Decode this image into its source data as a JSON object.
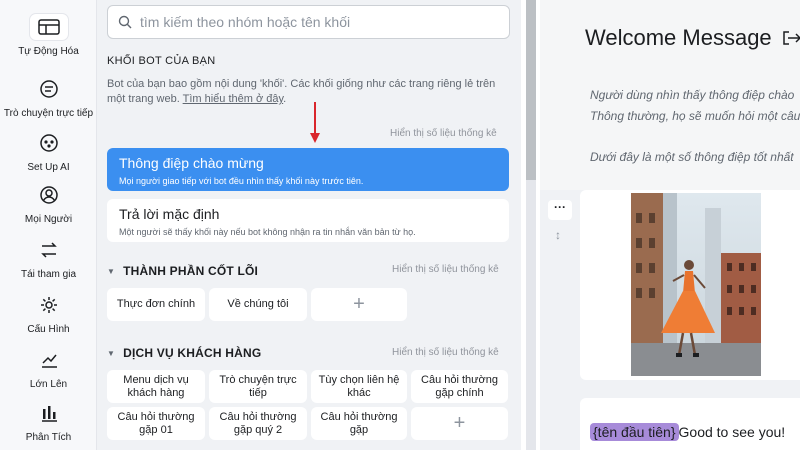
{
  "nav": {
    "items": [
      {
        "label": "Tự Động Hóa",
        "icon": "automation-icon"
      },
      {
        "label": "Trò chuyện trực tiếp",
        "icon": "chat-icon"
      },
      {
        "label": "Set Up AI",
        "icon": "ai-icon"
      },
      {
        "label": "Mọi Người",
        "icon": "people-icon"
      },
      {
        "label": "Tái tham gia",
        "icon": "reengage-icon"
      },
      {
        "label": "Cấu Hình",
        "icon": "gear-icon"
      },
      {
        "label": "Lớn Lên",
        "icon": "grow-icon"
      },
      {
        "label": "Phân Tích",
        "icon": "analytics-icon"
      }
    ]
  },
  "search": {
    "placeholder": "tìm kiếm theo nhóm hoặc tên khối"
  },
  "blocks_section": {
    "title": "KHỐI BOT CỦA BẠN",
    "desc_text": "Bot của bạn bao gồm nội dung 'khối'. Các khối giống như các trang riêng lẻ trên một trang web. ",
    "learn_more": "Tìm hiểu thêm ở đây",
    "desc_end": ".",
    "stats_label": "Hiển thị số liệu thống kê",
    "cards": [
      {
        "title": "Thông điệp chào mừng",
        "subtitle": "Mọi người giao tiếp với bot đều nhìn thấy khối này trước tiên."
      },
      {
        "title": "Trả lời mặc định",
        "subtitle": "Một người sẽ thấy khối này nếu bot không nhận ra tin nhắn văn bản từ họ."
      }
    ]
  },
  "groups": [
    {
      "title": "THÀNH PHẦN CỐT LÕI",
      "stats_label": "Hiển thị số liệu thống kê",
      "chips": [
        "Thực đơn chính",
        "Về chúng tôi",
        "+"
      ]
    },
    {
      "title": "DỊCH VỤ KHÁCH HÀNG",
      "stats_label": "Hiển thị số liệu thống kê",
      "chips": [
        "Menu dịch vụ khách hàng",
        "Trò chuyện trực tiếp",
        "Tùy chọn liên hệ khác",
        "Câu hỏi thường gặp chính",
        "Câu hỏi thường gặp 01",
        "Câu hỏi thường gặp quý 2",
        "Câu hỏi thường gặp",
        "+"
      ]
    }
  ],
  "editor": {
    "title": "Welcome Message",
    "line1": "Người dùng nhìn thấy thông điệp chào",
    "line2": "Thông thường, họ sẽ muốn hỏi một câu",
    "line3": "Dưới đây là một số thông điệp tốt nhất",
    "menu_label": "···",
    "message_tag": "{tên đầu tiên}",
    "message_rest": "Good to see you!"
  },
  "colors": {
    "accent": "#3b8ff0",
    "tag": "#a78bd9",
    "arrow": "#d9262c"
  }
}
